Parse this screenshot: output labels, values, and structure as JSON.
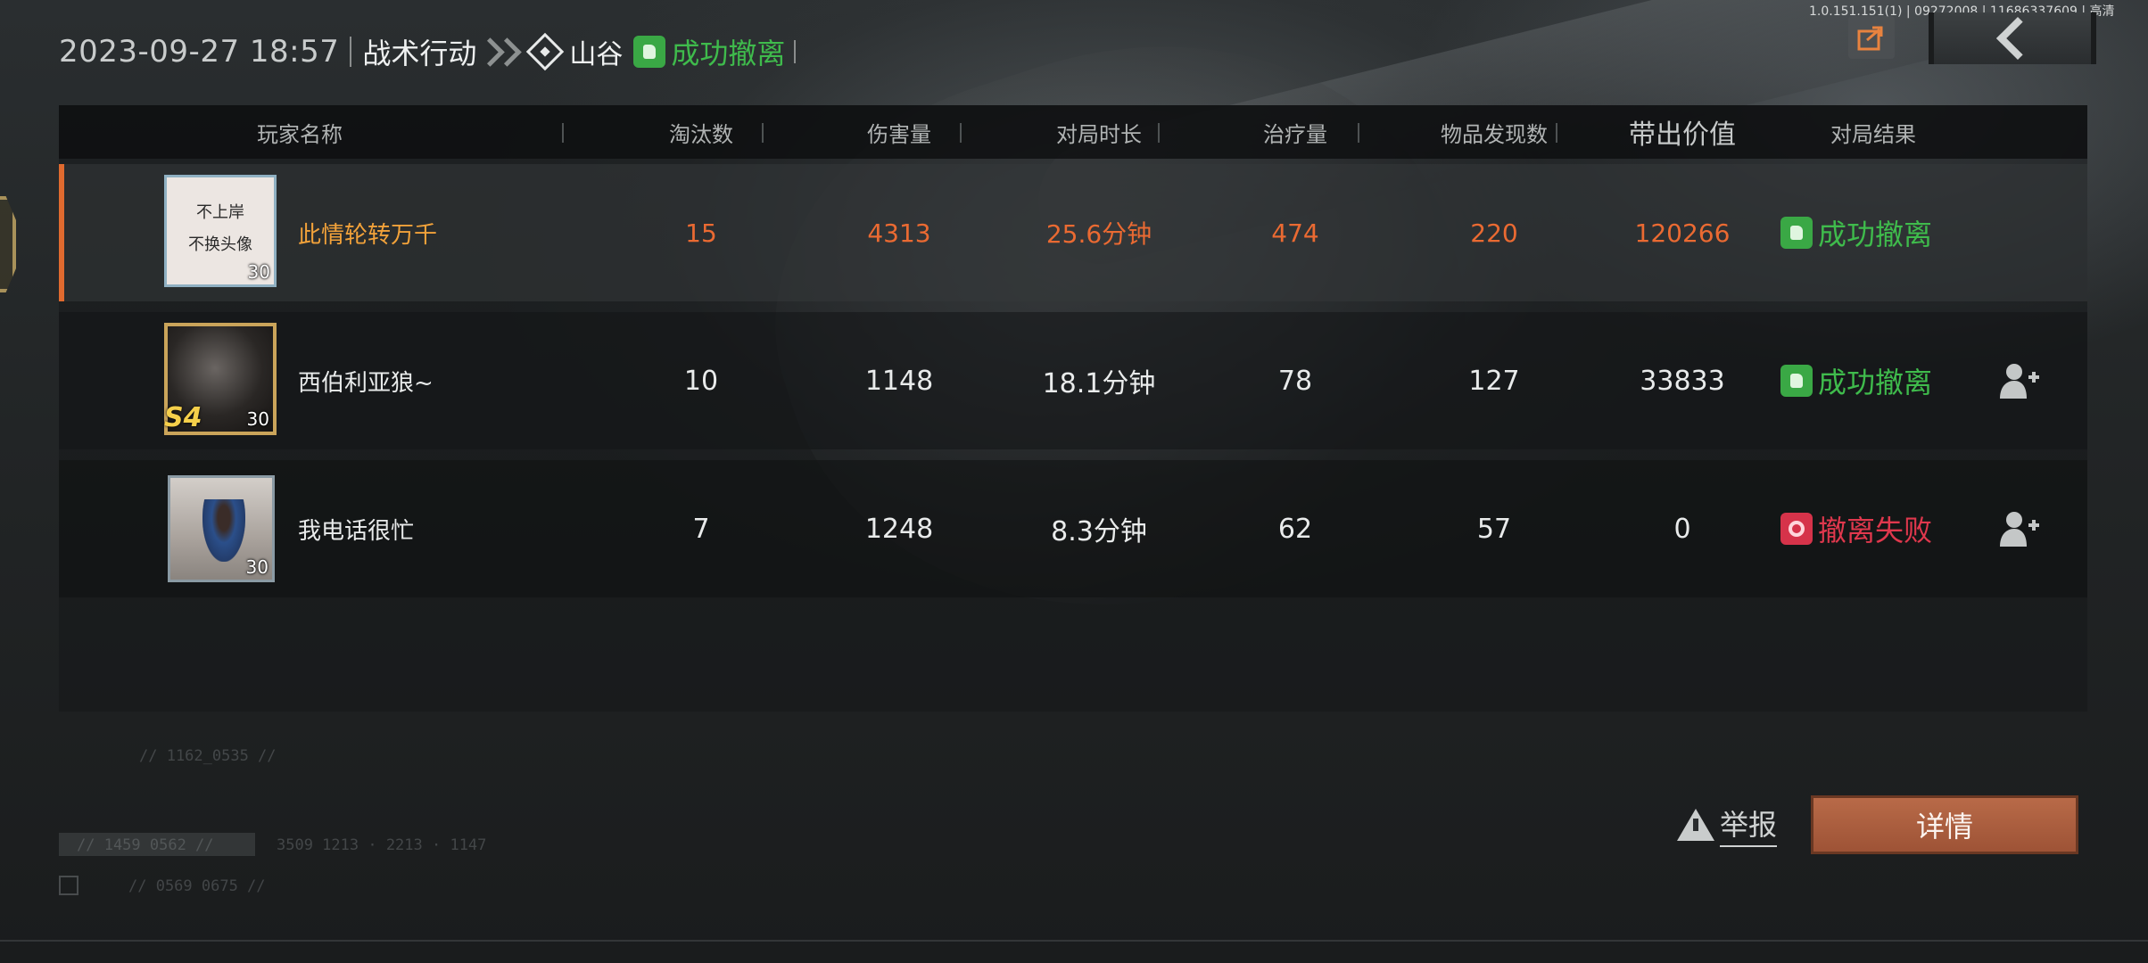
{
  "version_text": "1.0.151.151(1) | 09272008 | 11686337609 | 高清",
  "header": {
    "datetime": "2023-09-27 18:57",
    "mode": "战术行动",
    "map": "山谷",
    "result": "成功撤离"
  },
  "table": {
    "columns": [
      "玩家名称",
      "淘汰数",
      "伤害量",
      "对局时长",
      "治疗量",
      "物品发现数",
      "带出价值",
      "对局结果"
    ],
    "rows": [
      {
        "avatar_level": "30",
        "avatar_text": [
          "不上岸",
          "不换头像"
        ],
        "name": "此情轮转万千",
        "eliminations": "15",
        "damage": "4313",
        "duration": "25.6分钟",
        "healing": "474",
        "items_found": "220",
        "extracted_value": "120266",
        "result": "成功撤离",
        "result_type": "success",
        "highlight": true
      },
      {
        "avatar_level": "30",
        "avatar_badge": "S4",
        "name": "西伯利亚狼~",
        "eliminations": "10",
        "damage": "1148",
        "duration": "18.1分钟",
        "healing": "78",
        "items_found": "127",
        "extracted_value": "33833",
        "result": "成功撤离",
        "result_type": "success"
      },
      {
        "avatar_level": "30",
        "name": "我电话很忙",
        "eliminations": "7",
        "damage": "1248",
        "duration": "8.3分钟",
        "healing": "62",
        "items_found": "57",
        "extracted_value": "0",
        "result": "撤离失败",
        "result_type": "fail"
      }
    ]
  },
  "faint_codes": {
    "code1": "// 1162_0535 //",
    "code2": "// 1459 0562 //",
    "code3": "3509 1213  ·  2213 · 1147",
    "code4": "//   0569 0675 //"
  },
  "buttons": {
    "report": "举报",
    "detail": "详情"
  },
  "colors": {
    "accent_orange": "#ea6a32",
    "highlight_name": "#f2a23a",
    "success_green": "#3fbb4c",
    "fail_red": "#e0384d",
    "detail_button": "#b86a48"
  },
  "icons": [
    "share-icon",
    "back-arrow-icon",
    "diamond-map-icon",
    "success-thumb-icon",
    "fail-icon",
    "add-friend-icon",
    "warning-icon"
  ]
}
